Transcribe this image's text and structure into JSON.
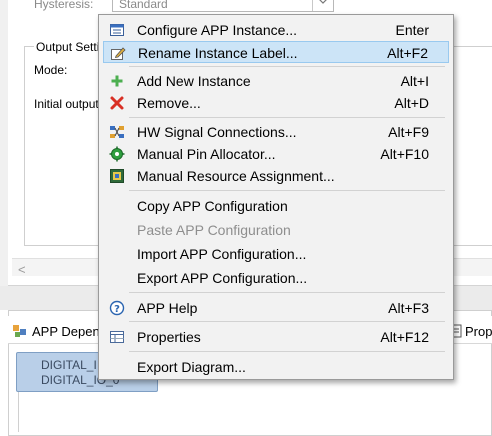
{
  "editor": {
    "hysteresis_label": "Hysteresis:",
    "hysteresis_value": "Standard",
    "output_group_title": "Output Setti",
    "mode_label": "Mode:",
    "initial_output_label": "Initial output"
  },
  "bottom_view": {
    "tab_label": "APP Depen",
    "right_tab_label": "Prop",
    "node_line1": "DIGITAL_I",
    "node_line2": "DIGITAL_IO_0"
  },
  "menu": {
    "items": [
      {
        "label": "Configure APP Instance...",
        "shortcut": "Enter",
        "icon": "configure-icon"
      },
      {
        "label": "Rename Instance Label...",
        "shortcut": "Alt+F2",
        "icon": "rename-icon",
        "highlighted": true
      },
      {
        "label": "Add New Instance",
        "shortcut": "Alt+I",
        "icon": "add-icon"
      },
      {
        "label": "Remove...",
        "shortcut": "Alt+D",
        "icon": "remove-icon"
      },
      {
        "label": "HW Signal Connections...",
        "shortcut": "Alt+F9",
        "icon": "signal-connections-icon"
      },
      {
        "label": "Manual Pin Allocator...",
        "shortcut": "Alt+F10",
        "icon": "pin-allocator-icon"
      },
      {
        "label": "Manual Resource Assignment...",
        "shortcut": "",
        "icon": "resource-assignment-icon"
      },
      {
        "label": "Copy APP Configuration",
        "shortcut": ""
      },
      {
        "label": "Paste APP Configuration",
        "shortcut": "",
        "disabled": true
      },
      {
        "label": "Import APP Configuration...",
        "shortcut": ""
      },
      {
        "label": "Export APP Configuration...",
        "shortcut": ""
      },
      {
        "label": "APP Help",
        "shortcut": "Alt+F3",
        "icon": "help-icon"
      },
      {
        "label": "Properties",
        "shortcut": "Alt+F12",
        "icon": "properties-icon"
      },
      {
        "label": "Export Diagram...",
        "shortcut": ""
      }
    ]
  }
}
